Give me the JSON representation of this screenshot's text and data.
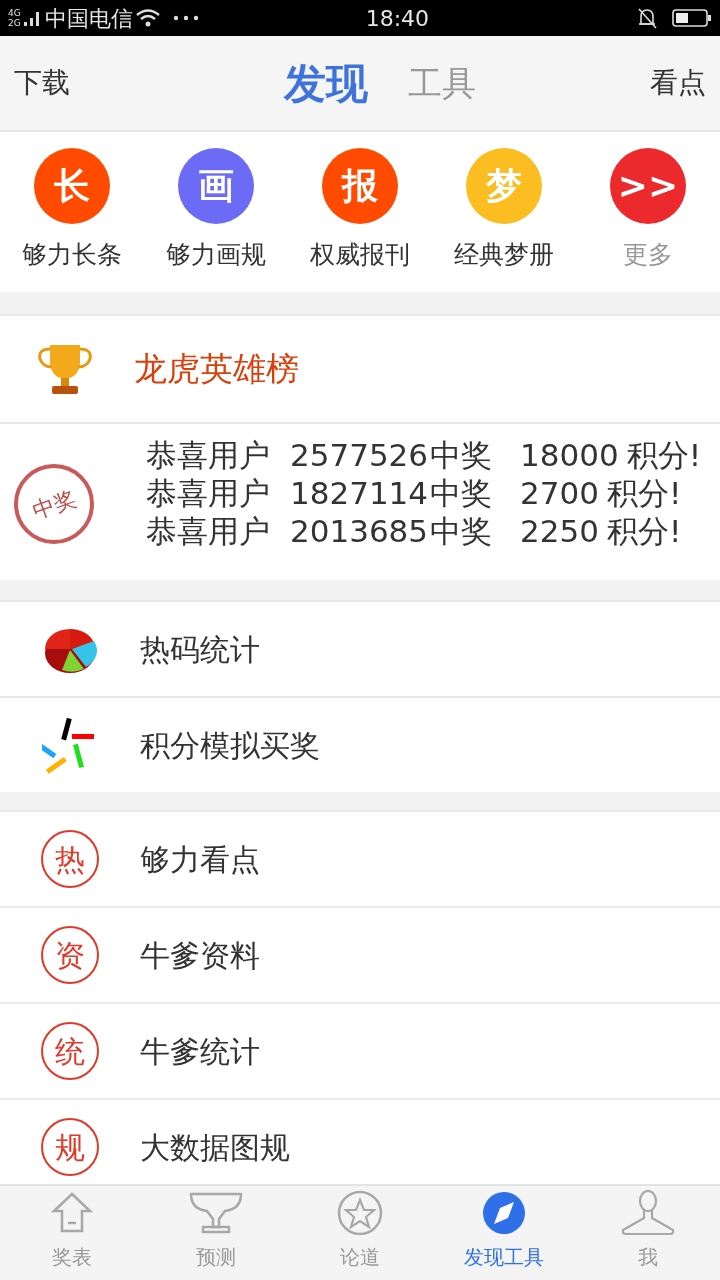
{
  "status_bar": {
    "network": [
      "4G",
      "2G"
    ],
    "carrier": "中国电信",
    "time": "18:40"
  },
  "header": {
    "left": "下载",
    "right": "看点",
    "tabs": [
      {
        "label": "发现",
        "selected": true
      },
      {
        "label": "工具",
        "selected": false
      }
    ]
  },
  "shortcuts": [
    {
      "glyph": "长",
      "label": "够力长条",
      "color": "#ff4a00",
      "kind": "app"
    },
    {
      "glyph": "画",
      "label": "够力画规",
      "color": "#6b6bf5",
      "kind": "app"
    },
    {
      "glyph": "报",
      "label": "权威报刊",
      "color": "#ff4a00",
      "kind": "app"
    },
    {
      "glyph": "梦",
      "label": "经典梦册",
      "color": "#fbbd22",
      "kind": "app"
    },
    {
      "glyph": ">>",
      "label": "更多",
      "color": "#ec2a2e",
      "kind": "more"
    }
  ],
  "leaderboard": {
    "title": "龙虎英雄榜",
    "stamp": "中奖",
    "winners": [
      {
        "prefix": "恭喜用户",
        "user": "2577526",
        "mid": "中奖",
        "points": "18000",
        "suffix": "积分!"
      },
      {
        "prefix": "恭喜用户",
        "user": "1827114",
        "mid": "中奖",
        "points": "2700",
        "suffix": "积分!"
      },
      {
        "prefix": "恭喜用户",
        "user": "2013685",
        "mid": "中奖",
        "points": "2250",
        "suffix": "积分!"
      }
    ]
  },
  "groups": [
    [
      {
        "kind": "pie",
        "label": "热码统计"
      },
      {
        "kind": "sticks",
        "label": "积分模拟买奖"
      }
    ],
    [
      {
        "kind": "badge",
        "glyph": "热",
        "label": "够力看点"
      },
      {
        "kind": "badge",
        "glyph": "资",
        "label": "牛爹资料"
      },
      {
        "kind": "badge",
        "glyph": "统",
        "label": "牛爹统计"
      },
      {
        "kind": "badge",
        "glyph": "规",
        "label": "大数据图规"
      }
    ]
  ],
  "nav": [
    {
      "kind": "home",
      "label": "奖表",
      "selected": false
    },
    {
      "kind": "trophy",
      "label": "预测",
      "selected": false
    },
    {
      "kind": "star",
      "label": "论道",
      "selected": false
    },
    {
      "kind": "compass",
      "label": "发现工具",
      "selected": true
    },
    {
      "kind": "person",
      "label": "我",
      "selected": false
    }
  ]
}
